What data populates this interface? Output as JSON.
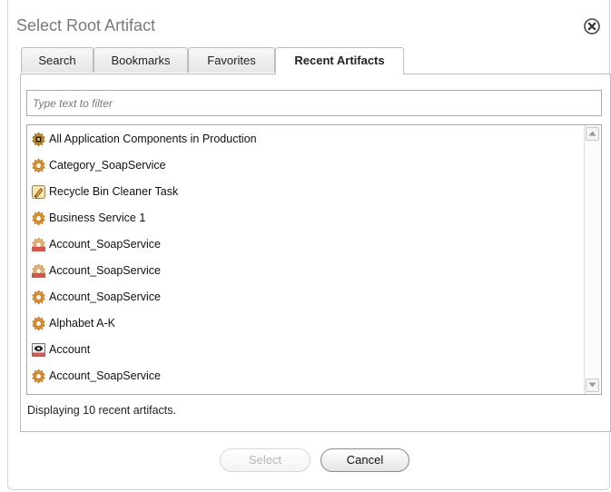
{
  "dialog": {
    "title": "Select Root Artifact",
    "close_icon": "close-circle-icon"
  },
  "tabs": [
    {
      "label": "Search",
      "active": false
    },
    {
      "label": "Bookmarks",
      "active": false
    },
    {
      "label": "Favorites",
      "active": false
    },
    {
      "label": "Recent Artifacts",
      "active": true
    }
  ],
  "filter": {
    "placeholder": "Type text to filter",
    "value": ""
  },
  "items": [
    {
      "label": "All Application Components in Production",
      "icon": "app-component-icon"
    },
    {
      "label": "Category_SoapService",
      "icon": "gear-icon"
    },
    {
      "label": "Recycle Bin Cleaner Task",
      "icon": "task-icon"
    },
    {
      "label": "Business Service 1",
      "icon": "gear-icon"
    },
    {
      "label": "Account_SoapService",
      "icon": "gear-draft-icon"
    },
    {
      "label": "Account_SoapService",
      "icon": "gear-draft-icon"
    },
    {
      "label": "Account_SoapService",
      "icon": "gear-icon"
    },
    {
      "label": "Alphabet A-K",
      "icon": "gear-icon"
    },
    {
      "label": "Account",
      "icon": "account-entity-icon"
    },
    {
      "label": "Account_SoapService",
      "icon": "gear-icon"
    }
  ],
  "status": "Displaying 10 recent artifacts.",
  "buttons": {
    "select": "Select",
    "cancel": "Cancel"
  },
  "colors": {
    "gear": "#e0922f",
    "gear_center": "#fff4dc",
    "draft_badge": "#d9534f",
    "border": "#bdbdbd"
  }
}
